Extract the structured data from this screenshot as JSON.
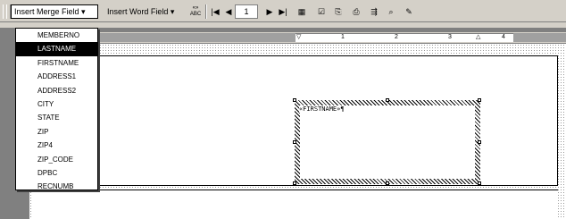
{
  "toolbar": {
    "insert_merge_field_label": "Insert Merge Field ▾",
    "insert_word_field_label": "Insert Word Field ▾",
    "view_merged_data_label": "«»\nABC",
    "record_number": "1"
  },
  "merge_field_menu": {
    "items": [
      "MEMBERNO",
      "LASTNAME",
      "FIRSTNAME",
      "ADDRESS1",
      "ADDRESS2",
      "CITY",
      "STATE",
      "ZIP",
      "ZIP4",
      "ZIP_CODE",
      "DPBC",
      "RECNUMB"
    ],
    "selected_index": 1
  },
  "ruler": {
    "labels": [
      "1",
      "2",
      "3",
      "4"
    ]
  },
  "document": {
    "field_text": "«FIRSTNAME»¶"
  },
  "colors": {
    "toolbar_bg": "#d4d0c8",
    "selection": "#000000"
  },
  "icons": [
    "first-record-icon",
    "previous-record-icon",
    "next-record-icon",
    "last-record-icon",
    "mail-merge-helper-icon",
    "check-errors-icon",
    "merge-to-document-icon",
    "merge-to-printer-icon",
    "start-mail-merge-icon",
    "find-record-icon",
    "edit-data-source-icon"
  ]
}
